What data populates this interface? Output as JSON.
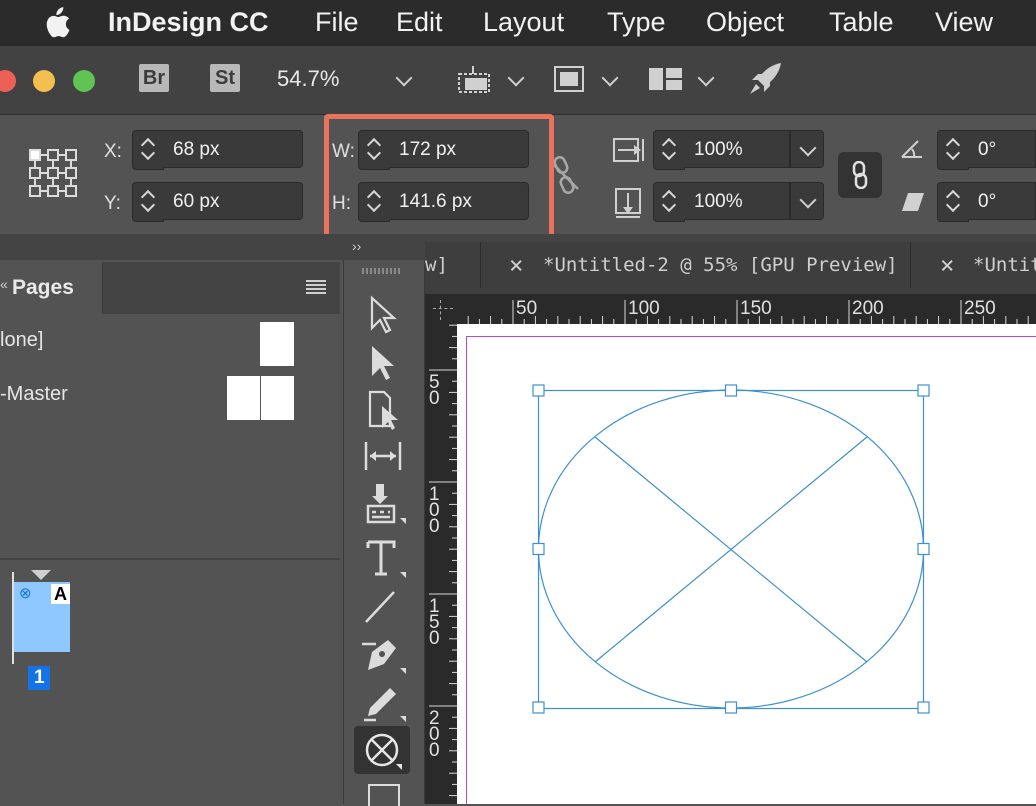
{
  "menubar": {
    "app_name": "InDesign CC",
    "items": [
      "File",
      "Edit",
      "Layout",
      "Type",
      "Object",
      "Table",
      "View"
    ]
  },
  "control_bar": {
    "bridge_label": "Br",
    "stock_label": "St",
    "zoom": "54.7%"
  },
  "transform": {
    "x_label": "X:",
    "x_value": "68 px",
    "y_label": "Y:",
    "y_value": "60 px",
    "w_label": "W:",
    "w_value": "172 px",
    "h_label": "H:",
    "h_value": "141.6 px",
    "scale_x": "100%",
    "scale_y": "100%",
    "rotation": "0°",
    "shear": "0°"
  },
  "tabs": {
    "tab1_partial": "w]",
    "tab2": "*Untitled-2 @ 55% [GPU Preview]",
    "tab3_partial": "*Untit",
    "close_glyph": "×"
  },
  "pages_panel": {
    "title": "Pages",
    "none_item": "lone]",
    "master_item": "-Master",
    "master_prefix": "A",
    "page_number": "1"
  },
  "rulers": {
    "h_labels": [
      "50",
      "100",
      "150",
      "200",
      "250"
    ],
    "v_labels": [
      "50",
      "100",
      "150",
      "200"
    ]
  },
  "colors": {
    "accent_highlight": "#e8735a",
    "selection": "#3d8fd1",
    "margin_guide": "#b24dd8",
    "page_badge": "#1473e6"
  }
}
